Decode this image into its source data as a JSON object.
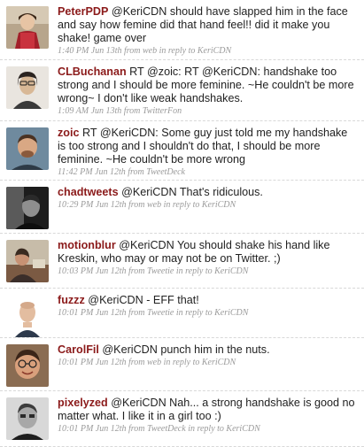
{
  "tweets": [
    {
      "user": "PeterPDP",
      "text": "@KeriCDN should have slapped him in the face and say how femine did that hand feel!! did it make you shake! game over",
      "meta": "1:40 PM Jun 13th from web in reply to KeriCDN",
      "avatar_icon": "avatar-woman-portrait-icon"
    },
    {
      "user": "CLBuchanan",
      "text": "RT @zoic: RT @KeriCDN: handshake too strong and I should be more feminine. ~He couldn't be more wrong~ I don't like weak handshakes.",
      "meta": "1:09 AM Jun 13th from TwitterFon",
      "avatar_icon": "avatar-woman-photo-icon"
    },
    {
      "user": "zoic",
      "text": "RT @KeriCDN: Some guy just told me my handshake is too strong and I shouldn't do that, I should be more feminine. ~He couldn't be more wrong",
      "meta": "11:42 PM Jun 12th from TweetDeck",
      "avatar_icon": "avatar-man-photo-icon"
    },
    {
      "user": "chadtweets",
      "text": "@KeriCDN That's ridiculous.",
      "meta": "10:29 PM Jun 12th from web in reply to KeriCDN",
      "avatar_icon": "avatar-man-dark-icon"
    },
    {
      "user": "motionblur",
      "text": "@KeriCDN You should shake his hand like Kreskin, who may or may not be on Twitter. ;)",
      "meta": "10:03 PM Jun 12th from Tweetie in reply to KeriCDN",
      "avatar_icon": "avatar-person-photo-icon"
    },
    {
      "user": "fuzzz",
      "text": "@KeriCDN - EFF that!",
      "meta": "10:01 PM Jun 12th from Tweetie in reply to KeriCDN",
      "avatar_icon": "avatar-man-bald-icon"
    },
    {
      "user": "CarolFil",
      "text": "@KeriCDN punch him in the nuts.",
      "meta": "10:01 PM Jun 12th from web in reply to KeriCDN",
      "avatar_icon": "avatar-man-glasses-icon"
    },
    {
      "user": "pixelyzed",
      "text": "@KeriCDN Nah... a strong handshake is good no matter what. I like it in a girl too :)",
      "meta": "10:01 PM Jun 12th from TweetDeck in reply to KeriCDN",
      "avatar_icon": "avatar-man-bw-icon"
    }
  ]
}
